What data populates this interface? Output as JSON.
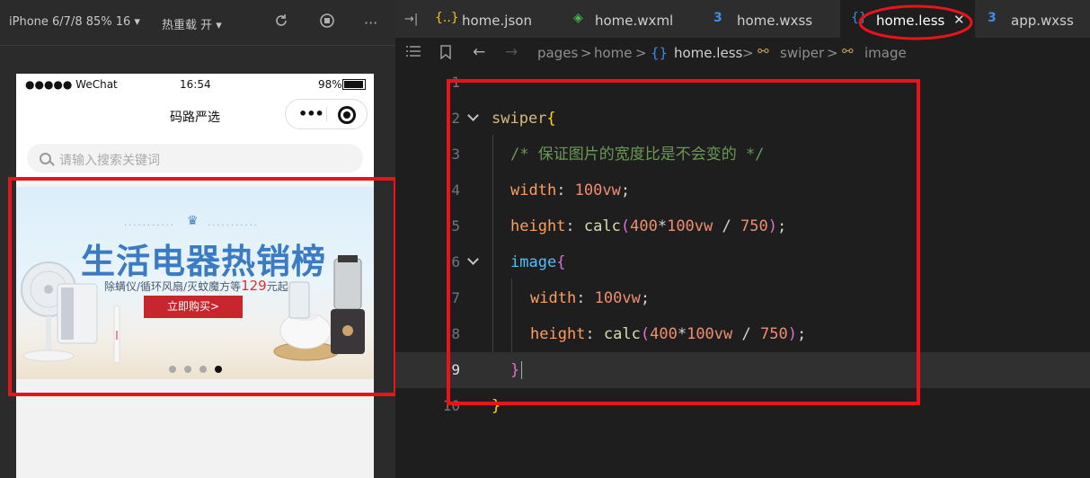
{
  "simulator": {
    "device": "iPhone 6/7/8 85% 16 ▾",
    "hot_reload": "热重载 开 ▾",
    "icons": [
      "refresh-icon",
      "stop-icon",
      "more-icon"
    ],
    "more": "···"
  },
  "phone": {
    "status_left": "●●●●● WeChat",
    "status_time": "16:54",
    "status_battery": "98%",
    "nav_title": "码路严选",
    "capsule_dots": "•••",
    "search_placeholder": "请输入搜索关键词"
  },
  "banner": {
    "title": "生活电器热销榜",
    "subtitle_pre": "除螨仪/循环风扇/灭蚊魔方等",
    "subtitle_price": "129",
    "subtitle_post": "元起",
    "button": "立即购买>",
    "dots_count": 4,
    "active_dot": 3
  },
  "editor": {
    "tabs": [
      {
        "icon": "{..}",
        "name": "home.json",
        "icon_color": "#f5c518"
      },
      {
        "icon": "◈",
        "name": "home.wxml",
        "icon_color": "#3fb950"
      },
      {
        "icon": "3",
        "name": "home.wxss",
        "icon_color": "#3d8ee8"
      },
      {
        "icon": "{}",
        "name": "home.less",
        "icon_color": "#3d8ee8",
        "active": true,
        "close": "✕"
      },
      {
        "icon": "3",
        "name": "app.wxss",
        "icon_color": "#3d8ee8"
      }
    ],
    "split_icon": "→|",
    "breadcrumb": {
      "items": [
        "pages",
        ">",
        "home",
        ">",
        "{}",
        "home.less",
        ">",
        "swiper",
        ">",
        "image"
      ]
    },
    "line_numbers": [
      "1",
      "2",
      "3",
      "4",
      "5",
      "6",
      "7",
      "8",
      "9",
      "10"
    ],
    "current_line": "9",
    "code": {
      "l2_sel": "swiper",
      "l2_br": "{",
      "l3_comment": "/* 保证图片的宽度比是不会变的 */",
      "l4_prop": "width",
      "l4_colon": ": ",
      "l4_val": "100vw",
      "l4_semi": ";",
      "l5_prop": "height",
      "l5_colon": ": ",
      "l5_fn": "calc",
      "l5_open": "(",
      "l5_a": "400",
      "l5_mul": "*",
      "l5_b": "100vw",
      "l5_div": " / ",
      "l5_c": "750",
      "l5_close": ")",
      "l5_semi": ";",
      "l6_sel": "image",
      "l6_br": "{",
      "l7_prop": "width",
      "l7_colon": ": ",
      "l7_val": "100vw",
      "l7_semi": ";",
      "l8_prop": "height",
      "l8_colon": ": ",
      "l8_fn": "calc",
      "l8_open": "(",
      "l8_a": "400",
      "l8_mul": "*",
      "l8_b": "100vw",
      "l8_div": " / ",
      "l8_c": "750",
      "l8_close": ")",
      "l8_semi": ";",
      "l9_br": "}",
      "l10_br": "}"
    }
  },
  "annotation_color": "#e8141b"
}
